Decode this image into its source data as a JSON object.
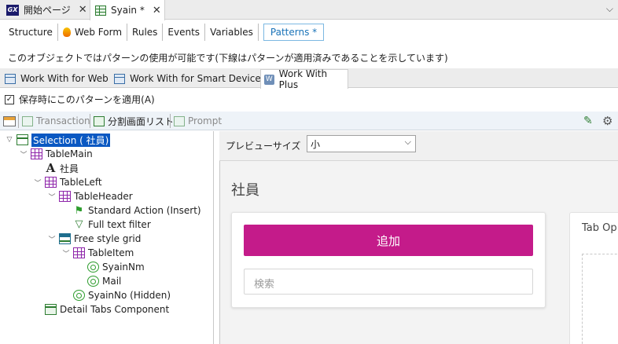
{
  "doc_tabs": [
    {
      "label": "開始ページ",
      "close": "✕"
    },
    {
      "label": "Syain *",
      "close": "✕"
    }
  ],
  "part_tabs": [
    "Structure",
    "Web Form",
    "Rules",
    "Events",
    "Variables",
    "Patterns *"
  ],
  "info_line": "このオブジェクトではパターンの使用が可能です(下線はパターンが適用済みであることを示しています)",
  "pattern_tabs": [
    "Work With for Web",
    "Work With for Smart Devices",
    "Work With Plus"
  ],
  "apply_label": "保存時にこのパターンを適用(A)",
  "toolbar": {
    "transaction": "Transaction",
    "split_list": "分割画面リスト",
    "prompt": "Prompt"
  },
  "tree": {
    "selection": "Selection ( 社員)",
    "table_main": "TableMain",
    "shain": "社員",
    "table_left": "TableLeft",
    "table_header": "TableHeader",
    "standard_action": "Standard Action (Insert)",
    "full_text_filter": "Full text filter",
    "free_style_grid": "Free style grid",
    "table_item": "TableItem",
    "syain_nm": "SyainNm",
    "mail": "Mail",
    "syain_no": "SyainNo (Hidden)",
    "detail_tabs": "Detail Tabs Component"
  },
  "preview": {
    "size_label": "プレビューサイズ",
    "size_value": "小",
    "title": "社員",
    "add_button": "追加",
    "search_placeholder": "検索",
    "tab_options": "Tab Op"
  },
  "colors": {
    "accent": "#c41b8a",
    "selection": "#0a58c2",
    "patterns_tab": "#1a73b8"
  }
}
